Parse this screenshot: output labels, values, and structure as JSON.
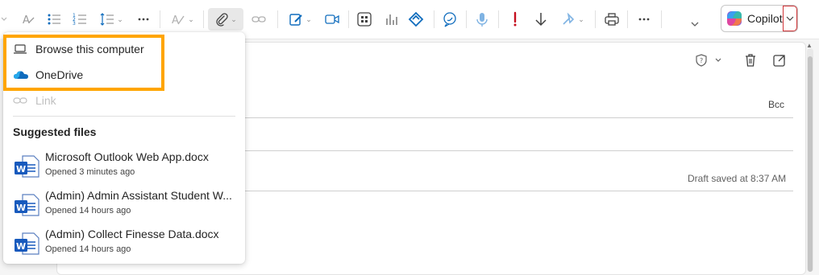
{
  "toolbar": {
    "copilot_label": "Copilot"
  },
  "compose": {
    "bcc_label": "Bcc",
    "draft_status": "Draft saved at 8:37 AM"
  },
  "attach_menu": {
    "items": [
      {
        "label": "Browse this computer",
        "icon": "laptop-icon"
      },
      {
        "label": "OneDrive",
        "icon": "onedrive-icon"
      },
      {
        "label": "Link",
        "icon": "link-icon",
        "disabled": true
      }
    ],
    "section_title": "Suggested files",
    "files": [
      {
        "name": "Microsoft Outlook Web App.docx",
        "subtitle": "Opened 3 minutes ago",
        "icon": "word-icon"
      },
      {
        "name": "(Admin) Admin Assistant Student W...",
        "subtitle": "Opened 14 hours ago",
        "icon": "word-icon"
      },
      {
        "name": "(Admin) Collect Finesse Data.docx",
        "subtitle": "Opened 14 hours ago",
        "icon": "word-icon"
      }
    ]
  },
  "colors": {
    "highlight": "#ffa500",
    "word_blue": "#185abd",
    "accent_blue": "#0f6cbd",
    "importance_red": "#c50f1f"
  }
}
